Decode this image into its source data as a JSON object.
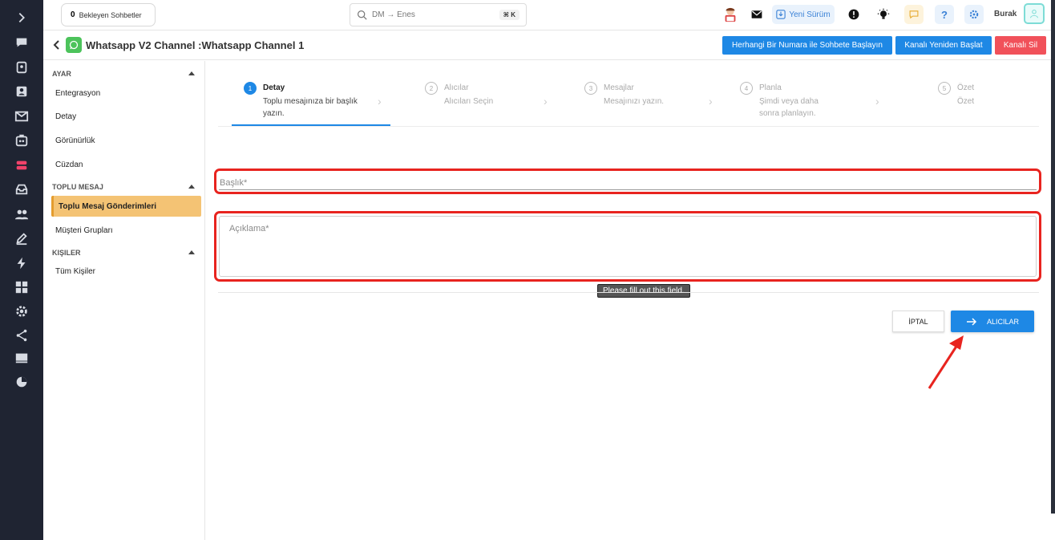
{
  "topbar": {
    "pending_count": "0",
    "pending_label": "Bekleyen Sohbetler",
    "search_placeholder": "DM → Enes",
    "search_shortcut": "⌘ K",
    "new_version_label": "Yeni Sürüm",
    "username": "Burak"
  },
  "header": {
    "title": "Whatsapp V2 Channel :Whatsapp Channel 1",
    "start_chat_button": "Herhangi Bir Numara ile Sohbete Başlayın",
    "restart_button": "Kanalı Yeniden Başlat",
    "delete_button": "Kanalı Sil"
  },
  "sidebar": {
    "sections": [
      {
        "title": "AYAR",
        "items": [
          "Entegrasyon",
          "Detay",
          "Görünürlük",
          "Cüzdan"
        ]
      },
      {
        "title": "TOPLU MESAJ",
        "items": [
          "Toplu Mesaj Gönderimleri",
          "Müşteri Grupları"
        ]
      },
      {
        "title": "KIŞILER",
        "items": [
          "Tüm Kişiler"
        ]
      }
    ],
    "active_item": "Toplu Mesaj Gönderimleri"
  },
  "stepper": {
    "steps": [
      {
        "num": "1",
        "title": "Detay",
        "desc": "Toplu mesajınıza bir başlık yazın.",
        "active": true
      },
      {
        "num": "2",
        "title": "Alıcılar",
        "desc": "Alıcıları Seçin",
        "active": false
      },
      {
        "num": "3",
        "title": "Mesajlar",
        "desc": "Mesajınızı yazın.",
        "active": false
      },
      {
        "num": "4",
        "title": "Planla",
        "desc": "Şimdi veya daha sonra planlayın.",
        "active": false
      },
      {
        "num": "5",
        "title": "Özet",
        "desc": "Özet",
        "active": false
      }
    ]
  },
  "form": {
    "title_placeholder": "Başlık*",
    "description_placeholder": "Açıklama*",
    "validation_tooltip": "Please fill out this field."
  },
  "actions": {
    "cancel_label": "İPTAL",
    "next_label": "ALICILAR"
  },
  "colors": {
    "primary": "#1e88e5",
    "danger": "#f1515a",
    "highlight": "#e8241f",
    "active_item": "#f4c374",
    "rail": "#1f2432"
  }
}
